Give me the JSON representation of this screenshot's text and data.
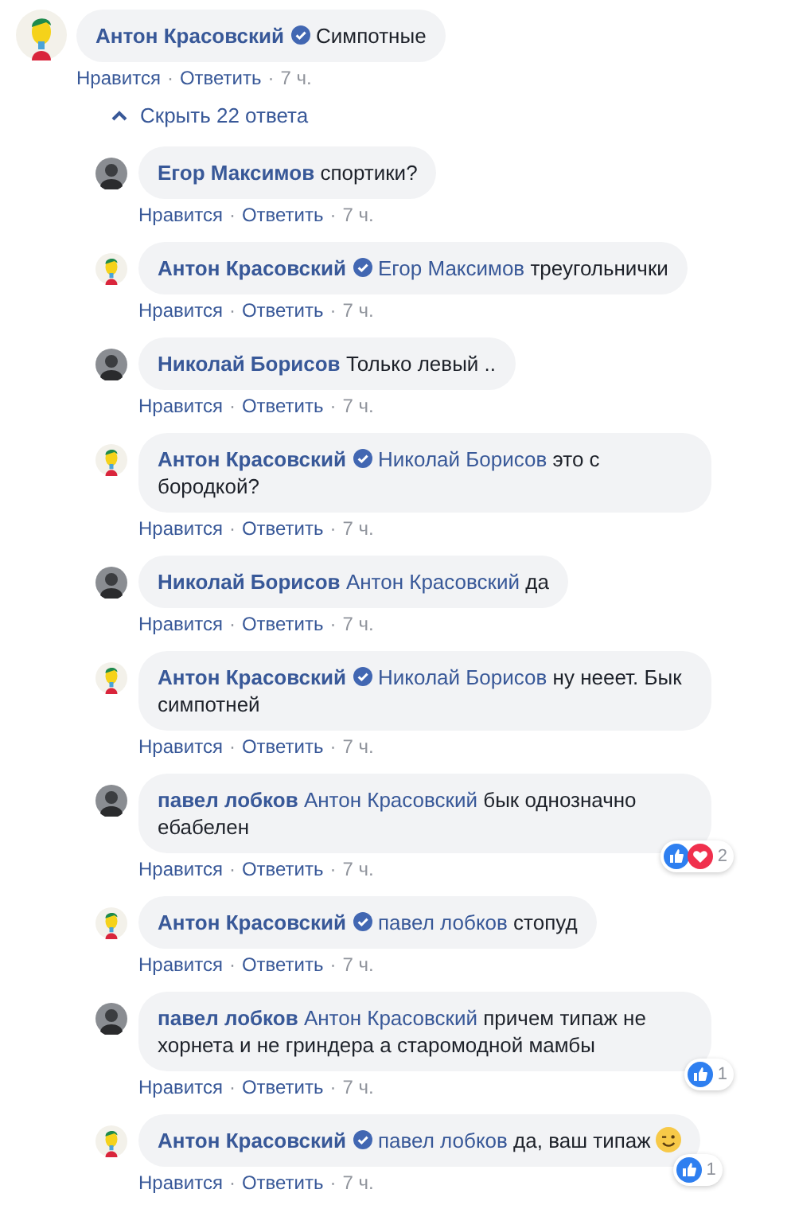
{
  "comment": {
    "author": "Антон Красовский",
    "verified": true,
    "text": "Симпотные",
    "actions": [
      {
        "kind": "link",
        "text": "Нравится"
      },
      {
        "kind": "dot",
        "text": "·"
      },
      {
        "kind": "link",
        "text": "Ответить"
      },
      {
        "kind": "dot",
        "text": "·"
      },
      {
        "kind": "time",
        "text": "7 ч."
      }
    ]
  },
  "replies_toggle": {
    "expanded": true,
    "label": "Скрыть 22 ответа"
  },
  "replies": [
    {
      "author": "Егор Максимов",
      "verified": false,
      "text": "спортики?",
      "actions": [
        {
          "kind": "link",
          "text": "Нравится"
        },
        {
          "kind": "dot",
          "text": "·"
        },
        {
          "kind": "link",
          "text": "Ответить"
        },
        {
          "kind": "dot",
          "text": "·"
        },
        {
          "kind": "time",
          "text": "7 ч."
        }
      ]
    },
    {
      "author": "Антон Красовский",
      "verified": true,
      "mention": "Егор Максимов",
      "text": "треугольнички",
      "actions": [
        {
          "kind": "link",
          "text": "Нравится"
        },
        {
          "kind": "dot",
          "text": "·"
        },
        {
          "kind": "link",
          "text": "Ответить"
        },
        {
          "kind": "dot",
          "text": "·"
        },
        {
          "kind": "time",
          "text": "7 ч."
        }
      ]
    },
    {
      "author": "Николай Борисов",
      "verified": false,
      "text": "Только левый ..",
      "actions": [
        {
          "kind": "link",
          "text": "Нравится"
        },
        {
          "kind": "dot",
          "text": "·"
        },
        {
          "kind": "link",
          "text": "Ответить"
        },
        {
          "kind": "dot",
          "text": "·"
        },
        {
          "kind": "time",
          "text": "7 ч."
        }
      ]
    },
    {
      "author": "Антон Красовский",
      "verified": true,
      "mention": "Николай Борисов",
      "text": "это с бородкой?",
      "actions": [
        {
          "kind": "link",
          "text": "Нравится"
        },
        {
          "kind": "dot",
          "text": "·"
        },
        {
          "kind": "link",
          "text": "Ответить"
        },
        {
          "kind": "dot",
          "text": "·"
        },
        {
          "kind": "time",
          "text": "7 ч."
        }
      ]
    },
    {
      "author": "Николай Борисов",
      "verified": false,
      "mention": "Антон Красовский",
      "text": "да",
      "actions": [
        {
          "kind": "link",
          "text": "Нравится"
        },
        {
          "kind": "dot",
          "text": "·"
        },
        {
          "kind": "link",
          "text": "Ответить"
        },
        {
          "kind": "dot",
          "text": "·"
        },
        {
          "kind": "time",
          "text": "7 ч."
        }
      ]
    },
    {
      "author": "Антон Красовский",
      "verified": true,
      "mention": "Николай Борисов",
      "text": "ну нееет. Бык симпотней",
      "actions": [
        {
          "kind": "link",
          "text": "Нравится"
        },
        {
          "kind": "dot",
          "text": "·"
        },
        {
          "kind": "link",
          "text": "Ответить"
        },
        {
          "kind": "dot",
          "text": "·"
        },
        {
          "kind": "time",
          "text": "7 ч."
        }
      ]
    },
    {
      "author": "павел лобков",
      "verified": false,
      "mention": "Антон Красовский",
      "text": "бык однозначно ебабелен",
      "reactions": {
        "love": true,
        "count": "2"
      },
      "actions": [
        {
          "kind": "link",
          "text": "Нравится"
        },
        {
          "kind": "dot",
          "text": "·"
        },
        {
          "kind": "link",
          "text": "Ответить"
        },
        {
          "kind": "dot",
          "text": "·"
        },
        {
          "kind": "time",
          "text": "7 ч."
        }
      ]
    },
    {
      "author": "Антон Красовский",
      "verified": true,
      "mention": "павел лобков",
      "text": "стопуд",
      "actions": [
        {
          "kind": "link",
          "text": "Нравится"
        },
        {
          "kind": "dot",
          "text": "·"
        },
        {
          "kind": "link",
          "text": "Ответить"
        },
        {
          "kind": "dot",
          "text": "·"
        },
        {
          "kind": "time",
          "text": "7 ч."
        }
      ]
    },
    {
      "author": "павел лобков",
      "verified": false,
      "mention": "Антон Красовский",
      "text": "причем типаж не хорнета и не гриндера а старомодной мамбы",
      "reactions": {
        "love": false,
        "count": "1"
      },
      "actions": [
        {
          "kind": "link",
          "text": "Нравится"
        },
        {
          "kind": "dot",
          "text": "·"
        },
        {
          "kind": "link",
          "text": "Ответить"
        },
        {
          "kind": "dot",
          "text": "·"
        },
        {
          "kind": "time",
          "text": "7 ч."
        }
      ]
    },
    {
      "author": "Антон Красовский",
      "verified": true,
      "mention": "павел лобков",
      "text": "да, ваш типаж",
      "wink_emoji": true,
      "reactions": {
        "love": false,
        "count": "1"
      },
      "actions": [
        {
          "kind": "link",
          "text": "Нравится"
        },
        {
          "kind": "dot",
          "text": "·"
        },
        {
          "kind": "link",
          "text": "Ответить"
        },
        {
          "kind": "dot",
          "text": "·"
        },
        {
          "kind": "time",
          "text": "7 ч."
        }
      ]
    }
  ]
}
